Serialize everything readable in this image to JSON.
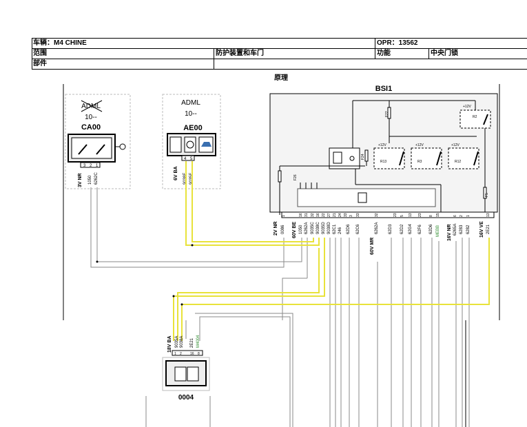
{
  "header": {
    "vehicle": "车辆：M4 CHINE",
    "opr": "OPR：13562",
    "range_label": "范围",
    "range_value": "防护装置和车门",
    "function_label": "功能",
    "function_value": "中央门锁",
    "part_label": "部件",
    "principle": "原理"
  },
  "components": {
    "ca00": {
      "title": "ADML",
      "sub": "10--",
      "code": "CA00",
      "pins": [
        "3",
        "2",
        "1"
      ],
      "power": "3V NR",
      "wires": [
        "1050",
        "6262C"
      ]
    },
    "ae00": {
      "title": "ADML",
      "sub": "10--",
      "code": "AE00",
      "pins": [
        "4",
        "5"
      ],
      "power": "6V BA",
      "wires": [
        "9038E",
        "9035E"
      ]
    },
    "bsi1": {
      "code": "BSI1",
      "relays": [
        "R13",
        "R3",
        "R12",
        "R2"
      ],
      "supply": "+12V",
      "fuses": [
        "F22",
        "F24",
        "F26",
        "F5"
      ],
      "connectors": [
        "2V NR",
        "60V BE",
        "60V MR",
        "16V NR",
        "16V VE"
      ],
      "pins": [
        "1",
        "16",
        "31",
        "32",
        "16",
        "22",
        "27",
        "21",
        "24",
        "33",
        "3",
        "33",
        "32",
        "23",
        "5",
        "13",
        "23",
        "8",
        "15",
        "6",
        "2",
        "1",
        "13"
      ],
      "wires": [
        "0086",
        "1050",
        "6262A",
        "9035C",
        "9038C",
        "9035D",
        "9038D",
        "62C1",
        "246",
        "62D6",
        "62C6",
        "6262A",
        "62D3",
        "62D2",
        "62G4",
        "62F6",
        "62D6",
        "MEBB",
        "6265A",
        "6283",
        "6282",
        "2E21"
      ]
    },
    "m0004": {
      "code": "0004",
      "power": "18V BA",
      "pins": [
        "1",
        "2",
        "16",
        "8"
      ],
      "wires": [
        "9035A",
        "9038A",
        "2E21",
        "M4004"
      ]
    }
  },
  "colors": {
    "yellow_wire": "#e8e23a",
    "grey_wire": "#8a8a8a",
    "green_label": "#2e8b2e",
    "box_border": "#a8a8a8"
  }
}
